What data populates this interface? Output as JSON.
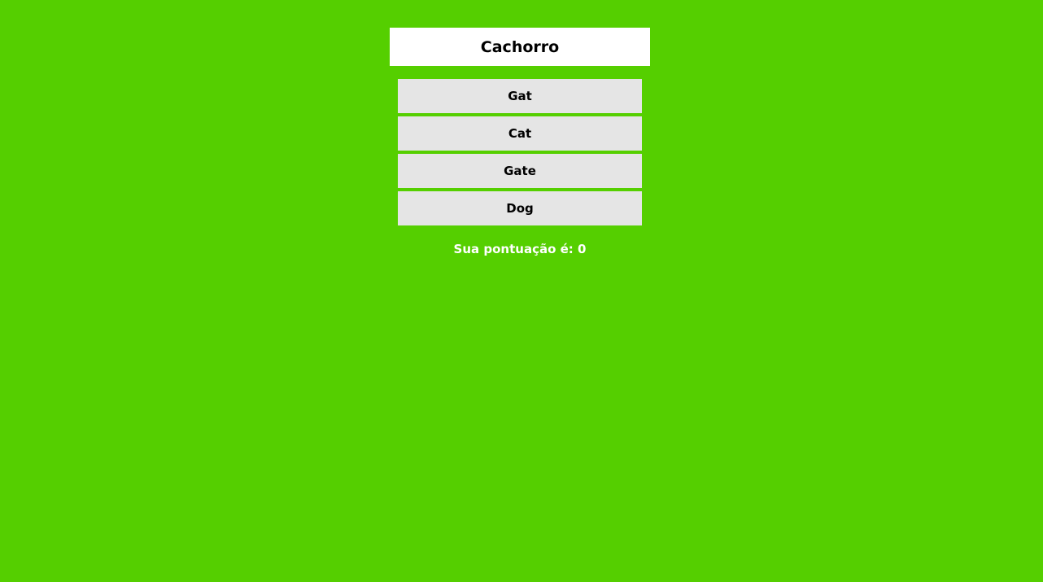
{
  "quiz": {
    "word": "Cachorro",
    "options": [
      {
        "label": "Gat"
      },
      {
        "label": "Cat"
      },
      {
        "label": "Gate"
      },
      {
        "label": "Dog"
      }
    ],
    "score_text": "Sua pontuação é: 0"
  },
  "colors": {
    "background": "#55cf00",
    "card": "#ffffff",
    "option": "#e5e5e5",
    "score_text": "#ffffff"
  }
}
